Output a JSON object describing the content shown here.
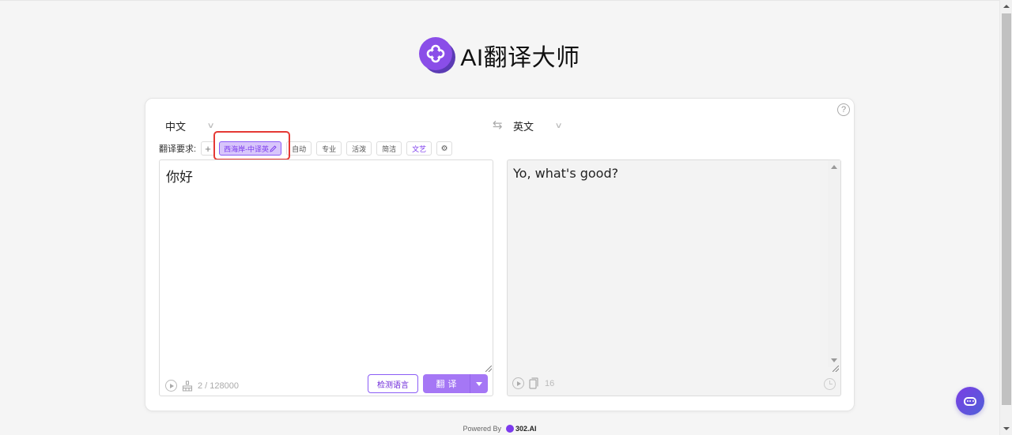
{
  "app": {
    "title": "AI翻译大师"
  },
  "languages": {
    "source": "中文",
    "target": "英文"
  },
  "requirements": {
    "label": "翻译要求:",
    "add_label": "+",
    "chips": [
      {
        "label": "西海岸-中译英",
        "active": true,
        "editable": true
      },
      {
        "label": "自动"
      },
      {
        "label": "专业"
      },
      {
        "label": "活泼"
      },
      {
        "label": "简洁"
      },
      {
        "label": "文艺",
        "purple": true
      }
    ]
  },
  "source_pane": {
    "text": "你好",
    "char_count": "2 / 128000",
    "detect_button": "检测语言",
    "translate_button": "翻译"
  },
  "target_pane": {
    "text": "Yo, what's good?",
    "char_count": "16"
  },
  "footer": {
    "powered_by": "Powered By",
    "brand": "302.AI"
  },
  "colors": {
    "accent": "#8b5cf6",
    "button": "#a577f5",
    "highlight": "#e53935"
  }
}
